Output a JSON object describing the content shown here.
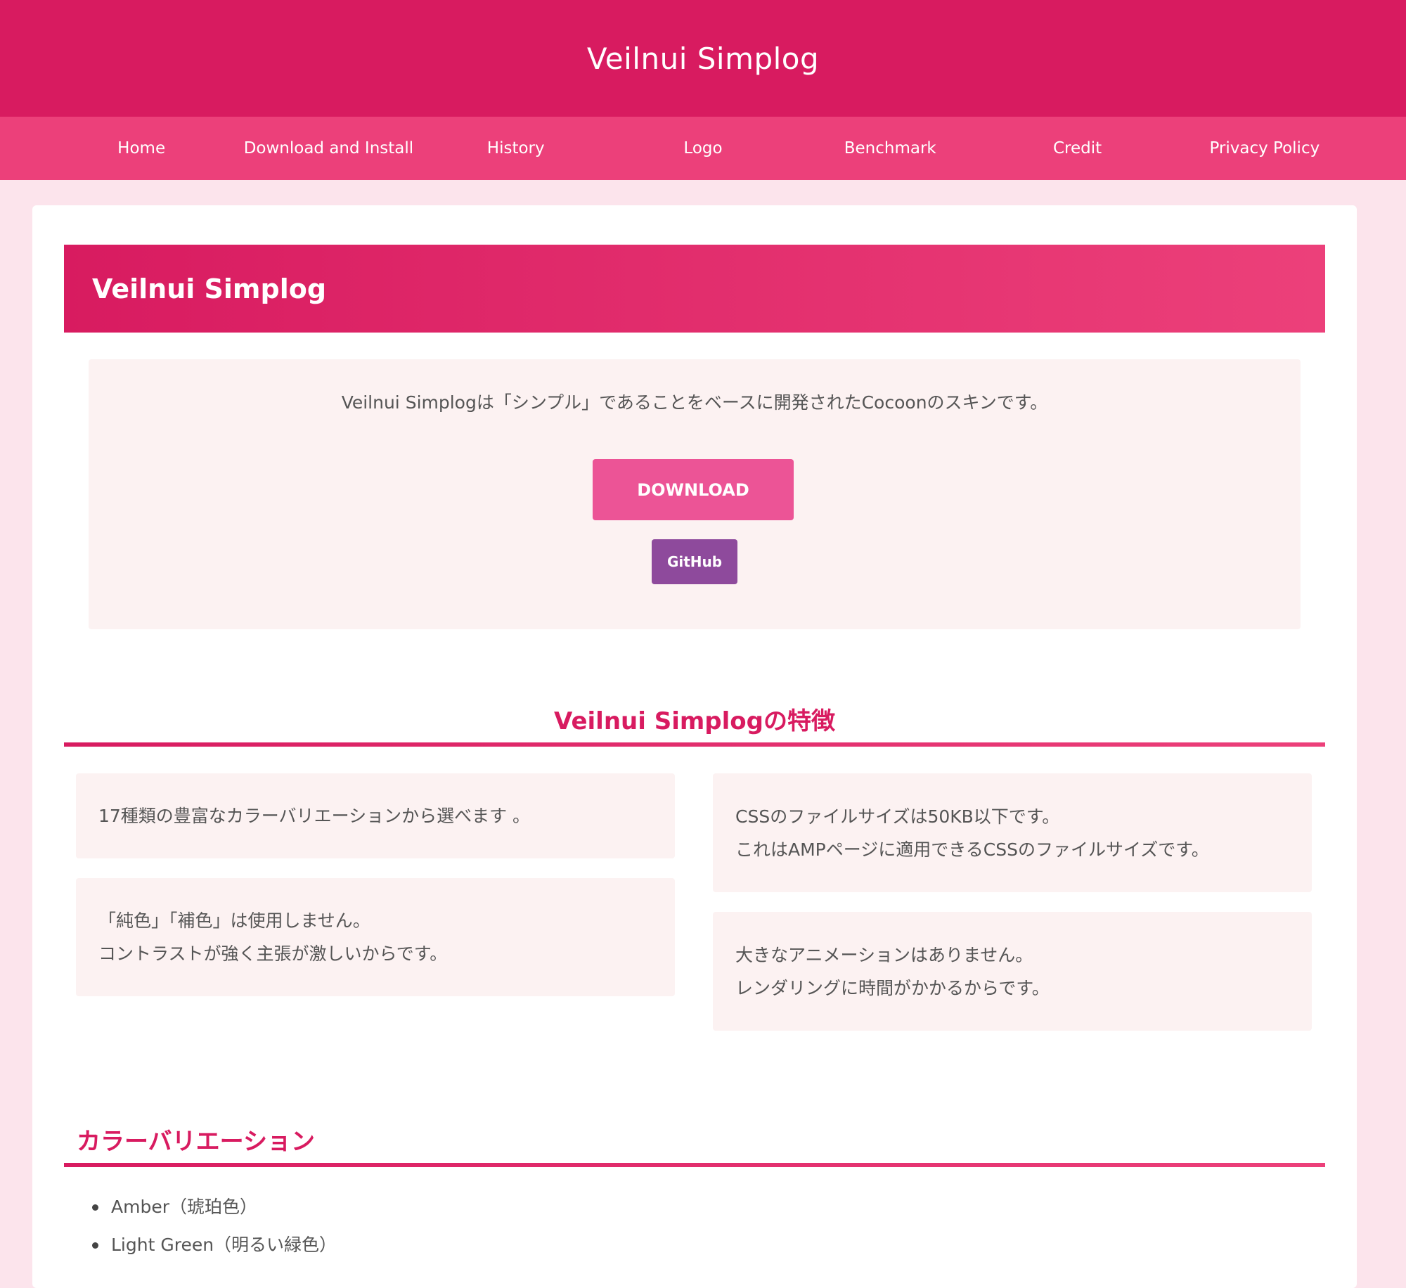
{
  "header": {
    "site_title": "Veilnui Simplog"
  },
  "nav": {
    "items": [
      {
        "label": "Home"
      },
      {
        "label": "Download and Install"
      },
      {
        "label": "History"
      },
      {
        "label": "Logo"
      },
      {
        "label": "Benchmark"
      },
      {
        "label": "Credit"
      },
      {
        "label": "Privacy Policy"
      }
    ]
  },
  "hero": {
    "title": "Veilnui Simplog"
  },
  "intro": {
    "text": "Veilnui Simplogは「シンプル」であることをベースに開発されたCocoonのスキンです。",
    "download_label": "DOWNLOAD",
    "github_label": "GitHub"
  },
  "features": {
    "heading": "Veilnui Simplogの特徴",
    "items": [
      {
        "lines": [
          "17種類の豊富なカラーバリエーションから選べます 。"
        ]
      },
      {
        "lines": [
          "「純色」「補色」は使用しません。",
          "コントラストが強く主張が激しいからです。"
        ]
      },
      {
        "lines": [
          "CSSのファイルサイズは50KB以下です。",
          "これはAMPページに適用できるCSSのファイルサイズです。"
        ]
      },
      {
        "lines": [
          "大きなアニメーションはありません。",
          "レンダリングに時間がかかるからです。"
        ]
      }
    ]
  },
  "colors": {
    "heading": "カラーバリエーション",
    "items": [
      "Amber（琥珀色）",
      "Light Green（明るい緑色）"
    ]
  },
  "theme": {
    "primary": "#d81b60",
    "nav_bg": "#ec407a",
    "page_bg": "#fce4ec",
    "box_bg": "#fcf2f2",
    "download_btn": "#ec5496",
    "github_btn": "#8e4a9c"
  }
}
